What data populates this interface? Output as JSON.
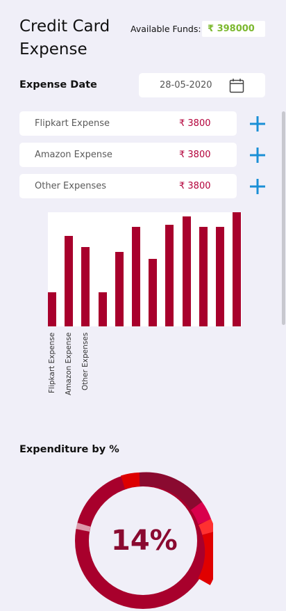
{
  "header": {
    "title": "Credit Card Expense",
    "funds_label": "Available Funds:",
    "funds_value": "₹ 398000",
    "funds_color": "#7cb82f"
  },
  "expense_date": {
    "label": "Expense Date",
    "value": "28-05-2020",
    "icon": "calendar-icon"
  },
  "expenses": [
    {
      "name": "Flipkart Expense",
      "amount": "₹ 3800"
    },
    {
      "name": "Amazon Expense",
      "amount": "₹ 3800"
    },
    {
      "name": "Other Expenses",
      "amount": "₹ 3800"
    }
  ],
  "add_icon": "plus-icon",
  "accent_color": "#1a8fd6",
  "chart_data": {
    "type": "bar",
    "categories": [
      "Flipkart Expense",
      "Amazon Expense",
      "Other Expenses",
      "",
      "",
      "",
      "",
      "",
      "",
      "",
      "",
      ""
    ],
    "values": [
      30,
      80,
      70,
      30,
      66,
      88,
      60,
      90,
      97,
      88,
      88,
      101
    ],
    "ylim": [
      0,
      101
    ],
    "grid": false,
    "bar_color": "#a8002c"
  },
  "expenditure": {
    "title": "Expenditure by %",
    "center_value": "14%",
    "colors": [
      "#8a0a30",
      "#d9004c",
      "#ff3030",
      "#e00000",
      "#c00000"
    ]
  }
}
